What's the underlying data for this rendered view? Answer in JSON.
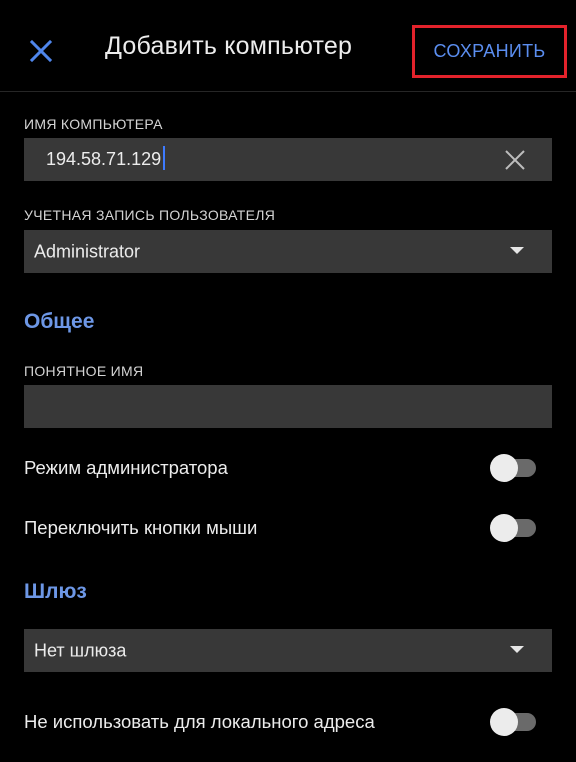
{
  "header": {
    "title": "Добавить компьютер",
    "save_label": "СОХРАНИТЬ",
    "close_icon": "close-icon"
  },
  "computer_name": {
    "label": "ИМЯ КОМПЬЮТЕРА",
    "value": "194.58.71.129"
  },
  "user_account": {
    "label": "УЧЕТНАЯ ЗАПИСЬ ПОЛЬЗОВАТЕЛЯ",
    "selected": "Administrator"
  },
  "general": {
    "title": "Общее",
    "friendly_name_label": "ПОНЯТНОЕ ИМЯ",
    "friendly_name_value": ""
  },
  "toggles": {
    "admin_mode": {
      "label": "Режим администратора",
      "on": false
    },
    "swap_mouse": {
      "label": "Переключить кнопки мыши",
      "on": false
    },
    "bypass_local": {
      "label": "Не использовать для локального адреса",
      "on": false
    }
  },
  "gateway": {
    "title": "Шлюз",
    "selected": "Нет шлюза"
  },
  "colors": {
    "accent": "#6d97e6",
    "save_text": "#5b8ef0",
    "highlight_border": "#e3222b",
    "field_bg": "#383838",
    "background": "#000000"
  }
}
